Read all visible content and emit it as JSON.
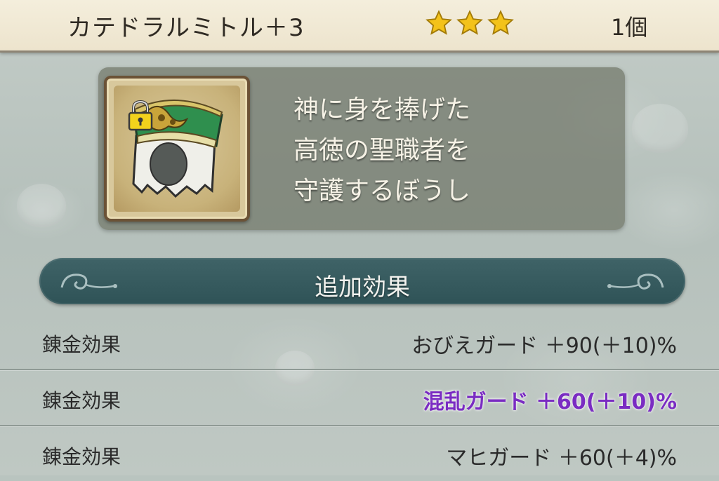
{
  "header": {
    "item_name": "カテドラルミトル＋3",
    "stars": 3,
    "quantity": "1個"
  },
  "item": {
    "icon": "mitre-hat-icon",
    "locked": true,
    "description": [
      "神に身を捧げた",
      "高徳の聖職者を",
      "守護するぼうし"
    ]
  },
  "section": {
    "title": "追加効果"
  },
  "effects": [
    {
      "label": "錬金効果",
      "value": "おびえガード ＋90(＋10)%",
      "highlight": false
    },
    {
      "label": "錬金効果",
      "value": "混乱ガード ＋60(＋10)%",
      "highlight": true
    },
    {
      "label": "錬金効果",
      "value": "マヒガード ＋60(＋4)%",
      "highlight": false
    }
  ],
  "colors": {
    "highlight": "#7a2cc2",
    "star": "#f3c21a",
    "banner": "#2f5357"
  }
}
